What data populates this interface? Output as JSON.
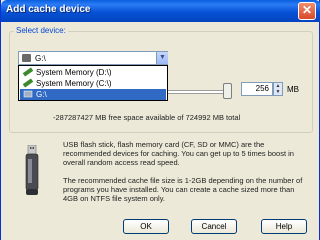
{
  "window": {
    "title": "Add cache device",
    "close_glyph": "✕"
  },
  "group": {
    "label": "Select device:"
  },
  "device_select": {
    "selected": "G:\\",
    "arrow_glyph": "▼"
  },
  "dropdown": {
    "items": [
      {
        "label": "System Memory (D:\\)",
        "icon": "memory-icon"
      },
      {
        "label": "System Memory (C:\\)",
        "icon": "memory-icon"
      },
      {
        "label": "G:\\",
        "icon": "drive-icon",
        "selected": true
      }
    ]
  },
  "cache_size": {
    "value": "256",
    "unit": "MB",
    "slider_fraction": 0.98
  },
  "free_space": "-287287427 MB free space available of 724992 MB total",
  "info": {
    "paragraph1": "USB flash stick, flash memory card (CF, SD or MMC) are the recommended devices for caching. You can get up to 5 times boost in overall random access read speed.",
    "paragraph2": "The recommended cache file size is 1-2GB depending on the number of programs you have installed. You can create a cache sized more than 4GB on NTFS file system only."
  },
  "buttons": {
    "ok": "OK",
    "cancel": "Cancel",
    "help": "Help"
  },
  "colors": {
    "titlebar": "#0752d6",
    "selection": "#316ac5",
    "group_label": "#0046d5"
  }
}
